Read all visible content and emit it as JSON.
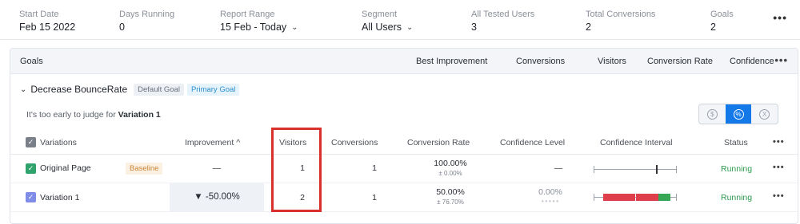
{
  "summary": [
    {
      "label": "Start Date",
      "value": "Feb 15 2022",
      "dropdown": false
    },
    {
      "label": "Days Running",
      "value": "0",
      "dropdown": false
    },
    {
      "label": "Report Range",
      "value": "15 Feb - Today",
      "dropdown": true
    },
    {
      "label": "Segment",
      "value": "All Users",
      "dropdown": true
    },
    {
      "label": "All Tested Users",
      "value": "3",
      "dropdown": false
    },
    {
      "label": "Total Conversions",
      "value": "2",
      "dropdown": false
    },
    {
      "label": "Goals",
      "value": "2",
      "dropdown": false
    }
  ],
  "more_glyph": "•••",
  "panel": {
    "title": "Goals",
    "columns": [
      "Best Improvement",
      "Conversions",
      "Visitors",
      "Conversion Rate",
      "Confidence"
    ]
  },
  "goal": {
    "name": "Decrease BounceRate",
    "tags": [
      "Default Goal",
      "Primary Goal"
    ],
    "notice_prefix": "It's too early to judge for",
    "notice_variation": "Variation 1"
  },
  "toggle": {
    "options": [
      "$",
      "%",
      "X"
    ],
    "active_index": 1
  },
  "table": {
    "headers": {
      "variations": "Variations",
      "improvement": "Improvement",
      "visitors": "Visitors",
      "conversions": "Conversions",
      "conversion_rate": "Conversion Rate",
      "confidence_level": "Confidence Level",
      "confidence_interval": "Confidence Interval",
      "status": "Status"
    },
    "sort_indicator": "^",
    "rows": [
      {
        "name": "Original Page",
        "badge": "Baseline",
        "improvement": "—",
        "visitors": "1",
        "conversions": "1",
        "rate": "100.00%",
        "rate_range": "± 0.00%",
        "confidence": "—",
        "confidence_dots": "",
        "status": "Running"
      },
      {
        "name": "Variation 1",
        "badge": "",
        "improvement": "▼ -50.00%",
        "visitors": "2",
        "conversions": "1",
        "rate": "50.00%",
        "rate_range": "± 76.70%",
        "confidence": "0.00%",
        "confidence_dots": "●●●●●",
        "status": "Running"
      }
    ]
  },
  "colors": {
    "accent": "#1378e8",
    "status_running": "#2e9a4e",
    "ci_negative": "#df3f4a",
    "ci_positive": "#36a855",
    "highlight": "#d8312c"
  }
}
